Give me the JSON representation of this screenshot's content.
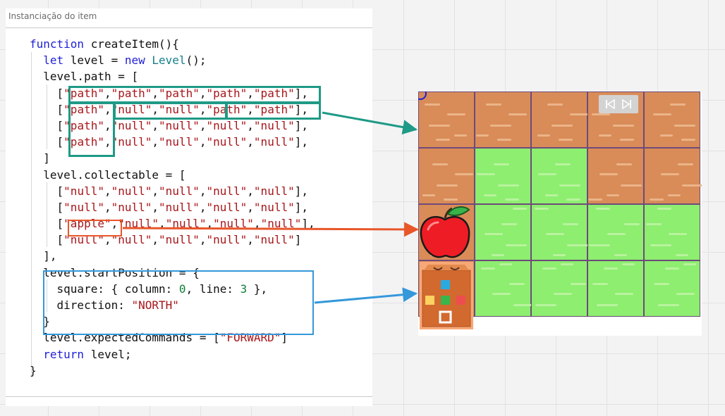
{
  "panel": {
    "title": "Instanciação do item"
  },
  "code": {
    "lines": [
      [
        {
          "t": "function ",
          "c": "k"
        },
        {
          "t": "createItem(){",
          "c": ""
        }
      ],
      [
        {
          "t": "  ",
          "c": ""
        },
        {
          "t": "let ",
          "c": "k"
        },
        {
          "t": "level = ",
          "c": ""
        },
        {
          "t": "new ",
          "c": "k"
        },
        {
          "t": "Level",
          "c": "cls"
        },
        {
          "t": "();",
          "c": ""
        }
      ],
      [
        {
          "t": "  level.path = [",
          "c": ""
        }
      ],
      [
        {
          "t": "    [",
          "c": ""
        },
        {
          "t": "\"path\"",
          "c": "s"
        },
        {
          "t": ",",
          "c": ""
        },
        {
          "t": "\"path\"",
          "c": "s"
        },
        {
          "t": ",",
          "c": ""
        },
        {
          "t": "\"path\"",
          "c": "s"
        },
        {
          "t": ",",
          "c": ""
        },
        {
          "t": "\"path\"",
          "c": "s"
        },
        {
          "t": ",",
          "c": ""
        },
        {
          "t": "\"path\"",
          "c": "s"
        },
        {
          "t": "],",
          "c": ""
        }
      ],
      [
        {
          "t": "    [",
          "c": ""
        },
        {
          "t": "\"path\"",
          "c": "s"
        },
        {
          "t": ",",
          "c": ""
        },
        {
          "t": "\"null\"",
          "c": "s"
        },
        {
          "t": ",",
          "c": ""
        },
        {
          "t": "\"null\"",
          "c": "s"
        },
        {
          "t": ",",
          "c": ""
        },
        {
          "t": "\"path\"",
          "c": "s"
        },
        {
          "t": ",",
          "c": ""
        },
        {
          "t": "\"path\"",
          "c": "s"
        },
        {
          "t": "],",
          "c": ""
        }
      ],
      [
        {
          "t": "    [",
          "c": ""
        },
        {
          "t": "\"path\"",
          "c": "s"
        },
        {
          "t": ",",
          "c": ""
        },
        {
          "t": "\"null\"",
          "c": "s"
        },
        {
          "t": ",",
          "c": ""
        },
        {
          "t": "\"null\"",
          "c": "s"
        },
        {
          "t": ",",
          "c": ""
        },
        {
          "t": "\"null\"",
          "c": "s"
        },
        {
          "t": ",",
          "c": ""
        },
        {
          "t": "\"null\"",
          "c": "s"
        },
        {
          "t": "],",
          "c": ""
        }
      ],
      [
        {
          "t": "    [",
          "c": ""
        },
        {
          "t": "\"path\"",
          "c": "s"
        },
        {
          "t": ",",
          "c": ""
        },
        {
          "t": "\"null\"",
          "c": "s"
        },
        {
          "t": ",",
          "c": ""
        },
        {
          "t": "\"null\"",
          "c": "s"
        },
        {
          "t": ",",
          "c": ""
        },
        {
          "t": "\"null\"",
          "c": "s"
        },
        {
          "t": ",",
          "c": ""
        },
        {
          "t": "\"null\"",
          "c": "s"
        },
        {
          "t": "],",
          "c": ""
        }
      ],
      [
        {
          "t": "  ]",
          "c": ""
        }
      ],
      [
        {
          "t": "  level.collectable = [",
          "c": ""
        }
      ],
      [
        {
          "t": "    [",
          "c": ""
        },
        {
          "t": "\"null\"",
          "c": "s"
        },
        {
          "t": ",",
          "c": ""
        },
        {
          "t": "\"null\"",
          "c": "s"
        },
        {
          "t": ",",
          "c": ""
        },
        {
          "t": "\"null\"",
          "c": "s"
        },
        {
          "t": ",",
          "c": ""
        },
        {
          "t": "\"null\"",
          "c": "s"
        },
        {
          "t": ",",
          "c": ""
        },
        {
          "t": "\"null\"",
          "c": "s"
        },
        {
          "t": "],",
          "c": ""
        }
      ],
      [
        {
          "t": "    [",
          "c": ""
        },
        {
          "t": "\"null\"",
          "c": "s"
        },
        {
          "t": ",",
          "c": ""
        },
        {
          "t": "\"null\"",
          "c": "s"
        },
        {
          "t": ",",
          "c": ""
        },
        {
          "t": "\"null\"",
          "c": "s"
        },
        {
          "t": ",",
          "c": ""
        },
        {
          "t": "\"null\"",
          "c": "s"
        },
        {
          "t": ",",
          "c": ""
        },
        {
          "t": "\"null\"",
          "c": "s"
        },
        {
          "t": "],",
          "c": ""
        }
      ],
      [
        {
          "t": "    [",
          "c": ""
        },
        {
          "t": "\"apple\"",
          "c": "s"
        },
        {
          "t": ",",
          "c": ""
        },
        {
          "t": "\"null\"",
          "c": "s"
        },
        {
          "t": ",",
          "c": ""
        },
        {
          "t": "\"null\"",
          "c": "s"
        },
        {
          "t": ",",
          "c": ""
        },
        {
          "t": "\"null\"",
          "c": "s"
        },
        {
          "t": ",",
          "c": ""
        },
        {
          "t": "\"null\"",
          "c": "s"
        },
        {
          "t": "],",
          "c": ""
        }
      ],
      [
        {
          "t": "    [",
          "c": ""
        },
        {
          "t": "\"null\"",
          "c": "s"
        },
        {
          "t": ",",
          "c": ""
        },
        {
          "t": "\"null\"",
          "c": "s"
        },
        {
          "t": ",",
          "c": ""
        },
        {
          "t": "\"null\"",
          "c": "s"
        },
        {
          "t": ",",
          "c": ""
        },
        {
          "t": "\"null\"",
          "c": "s"
        },
        {
          "t": ",",
          "c": ""
        },
        {
          "t": "\"null\"",
          "c": "s"
        },
        {
          "t": "]",
          "c": ""
        }
      ],
      [
        {
          "t": "  ],",
          "c": ""
        }
      ],
      [
        {
          "t": "  level.startPosition = {",
          "c": ""
        }
      ],
      [
        {
          "t": "    square: { column: ",
          "c": ""
        },
        {
          "t": "0",
          "c": "n"
        },
        {
          "t": ", line: ",
          "c": ""
        },
        {
          "t": "3",
          "c": "n"
        },
        {
          "t": " },",
          "c": ""
        }
      ],
      [
        {
          "t": "    direction: ",
          "c": ""
        },
        {
          "t": "\"NORTH\"",
          "c": "s"
        }
      ],
      [
        {
          "t": "  }",
          "c": ""
        }
      ],
      [
        {
          "t": "  level.expectedCommands = [",
          "c": ""
        },
        {
          "t": "\"FORWARD\"",
          "c": "s"
        },
        {
          "t": "]",
          "c": ""
        }
      ],
      [
        {
          "t": "  ",
          "c": ""
        },
        {
          "t": "return ",
          "c": "k"
        },
        {
          "t": "level;",
          "c": ""
        }
      ],
      [
        {
          "t": "}",
          "c": ""
        }
      ]
    ]
  },
  "game": {
    "grid": [
      [
        "path",
        "path",
        "path",
        "path",
        "path"
      ],
      [
        "path",
        "grass",
        "grass",
        "path",
        "path"
      ],
      [
        "path",
        "grass",
        "grass",
        "grass",
        "grass"
      ],
      [
        "path",
        "grass",
        "grass",
        "grass",
        "grass"
      ]
    ],
    "collectable": {
      "name": "apple-icon",
      "column": 0,
      "line": 2
    },
    "robot": {
      "name": "robot-icon",
      "column": 0,
      "line": 3,
      "direction": "NORTH"
    },
    "nav": {
      "prev_icon": "skip-previous-icon",
      "next_icon": "skip-next-icon"
    }
  },
  "colors": {
    "path_tile": "#d98c58",
    "grass_tile": "#8dee6f",
    "teal_highlight": "#1e9a86",
    "orange_highlight": "#e8562a",
    "blue_highlight": "#3498db",
    "keyword": "#1f1fd8",
    "string": "#a8161a",
    "number": "#0f7e3a"
  }
}
